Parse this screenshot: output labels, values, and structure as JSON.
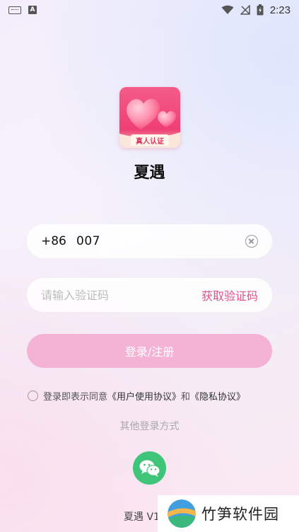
{
  "status_bar": {
    "time": "2:23"
  },
  "logo": {
    "badge": "真人认证"
  },
  "app": {
    "name": "夏遇"
  },
  "phone": {
    "country_code": "+86",
    "value": "007"
  },
  "code": {
    "placeholder": "请输入验证码",
    "get_code_label": "获取验证码"
  },
  "login": {
    "label": "登录/注册"
  },
  "agreement": {
    "prefix": "登录即表示同意",
    "user_agreement": "《用户使用协议》",
    "and": "和",
    "privacy": "《隐私协议》"
  },
  "other_login": {
    "label": "其他登录方式"
  },
  "version": {
    "text": "夏遇 V1"
  },
  "watermark": {
    "text": "竹笋软件园"
  },
  "colors": {
    "accent": "#e0508a",
    "button": "#f4b3d5",
    "wechat": "#3fc57a"
  }
}
